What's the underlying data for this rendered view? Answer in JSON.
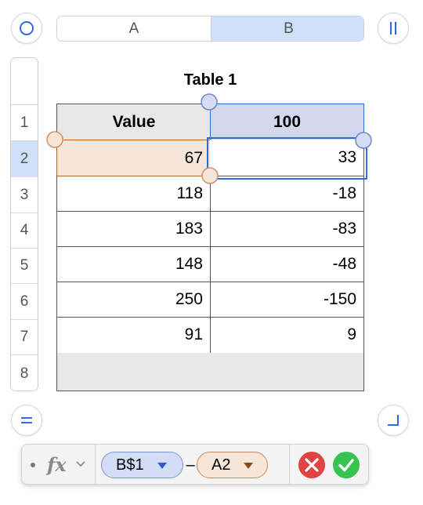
{
  "column_headers": [
    "A",
    "B"
  ],
  "row_headers": [
    "1",
    "2",
    "3",
    "4",
    "5",
    "6",
    "7",
    "8"
  ],
  "table": {
    "title": "Table 1",
    "header": [
      "Value",
      "100"
    ],
    "rows": [
      [
        "67",
        "33"
      ],
      [
        "118",
        "-18"
      ],
      [
        "183",
        "-83"
      ],
      [
        "148",
        "-48"
      ],
      [
        "250",
        "-150"
      ],
      [
        "91",
        "9"
      ],
      [
        "",
        ""
      ]
    ]
  },
  "formula": {
    "fx_label": "fx",
    "token_1": "B$1",
    "operator": "–",
    "token_2": "A2"
  },
  "colors": {
    "selected_column_header": "#cfe0fb",
    "header_row_bg": "#e8e8e8",
    "selected_header_cell": "#d3d7ee",
    "ref_a2_fill": "#f6e6d9",
    "ref_a2_border": "#b5652a",
    "ref_b1_fill": "#d4ddf6",
    "accent_blue": "#2f6bdc",
    "cancel_red": "#e04343",
    "accept_green": "#34c44f"
  }
}
